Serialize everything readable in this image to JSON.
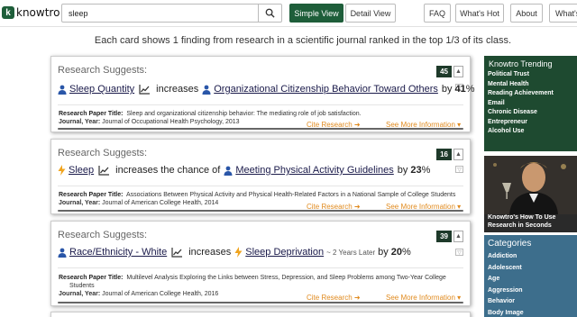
{
  "header": {
    "logo_letter": "k",
    "logo_text": "knowtro",
    "search_value": "sleep",
    "simple_view": "Simple View",
    "detail_view": "Detail View",
    "nav": [
      "FAQ",
      "What's Hot",
      "About",
      "What's"
    ]
  },
  "intro": "Each card shows 1 finding from research in a scientific journal ranked in the top 1/3 of its class.",
  "cards": [
    {
      "label": "Research Suggests:",
      "score": "45",
      "subject": "Sleep Quantity",
      "relation": "increases",
      "object": "Organizational Citizenship Behavior Toward Others",
      "by": "by",
      "pct": "41",
      "pct_sign": "%",
      "title_label": "Research Paper Title:",
      "title": "Sleep and organizational citizenship behavior: The mediating role of job satisfaction.",
      "journal_label": "Journal, Year:",
      "journal": "Journal of Occupational Health Psychology, 2013",
      "cite": "Cite Research ➜",
      "more": "See More Information ▾"
    },
    {
      "label": "Research Suggests:",
      "score": "16",
      "subject": "Sleep",
      "relation": "increases the chance of",
      "object": "Meeting Physical Activity Guidelines",
      "by": "by",
      "pct": "23",
      "pct_sign": "%",
      "title_label": "Research Paper Title:",
      "title": "Associations Between Physical Activity and Physical Health-Related Factors in a National Sample of College Students",
      "journal_label": "Journal, Year:",
      "journal": "Journal of American College Health, 2014",
      "cite": "Cite Research ➜",
      "more": "See More Information ▾"
    },
    {
      "label": "Research Suggests:",
      "score": "39",
      "subject": "Race/Ethnicity - White",
      "relation": "increases",
      "object": "Sleep Deprivation",
      "tilde": "~ 2 Years Later",
      "by": "by",
      "pct": "20",
      "pct_sign": "%",
      "title_label": "Research Paper Title:",
      "title_line1": "Multilevel Analysis Exploring the Links between Stress, Depression, and Sleep Problems among Two-Year College",
      "title_line2": "Students",
      "journal_label": "Journal, Year:",
      "journal": "Journal of American College Health, 2016",
      "cite": "Cite Research ➜",
      "more": "See More Information ▾"
    }
  ],
  "sidebar": {
    "trending_title": "Knowtro Trending",
    "trending": [
      "Political Trust",
      "Mental Health",
      "Reading Achievement",
      "Email",
      "Chronic Disease",
      "Entrepreneur",
      "Alcohol Use"
    ],
    "promo_line1": "Knowtro's How To Use",
    "promo_line2": "Research in Seconds",
    "categories_title": "Categories",
    "categories": [
      "Addiction",
      "Adolescent",
      "Age",
      "Aggression",
      "Behavior",
      "Body Image"
    ]
  },
  "colors": {
    "brand_green": "#1e5e3a",
    "link_orange": "#e08a1e",
    "category_blue": "#3d6e8c"
  },
  "icons": [
    "search-icon",
    "person-icon",
    "trend-chart-icon",
    "bolt-icon",
    "chevron-up-icon"
  ]
}
